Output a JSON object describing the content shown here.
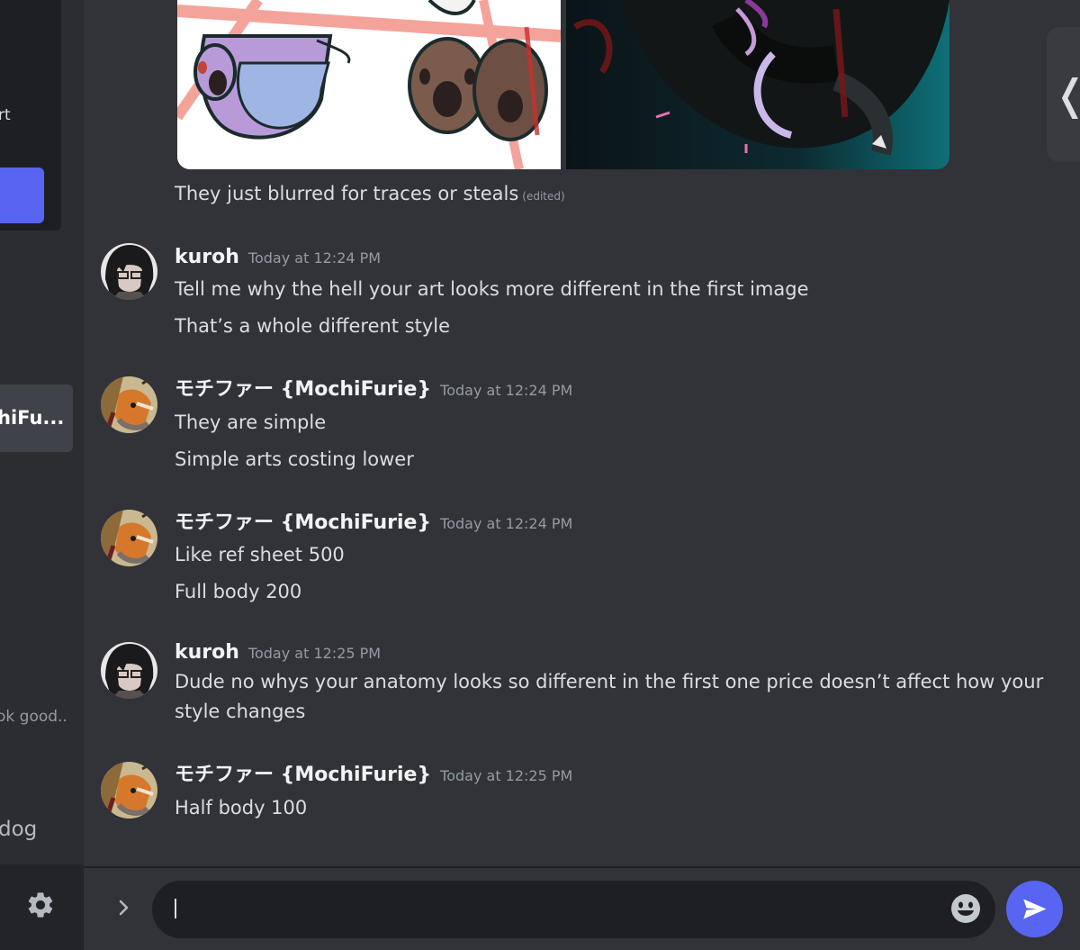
{
  "colors": {
    "background": "#313338",
    "sidebar": "#2b2d31",
    "blurple": "#5865f2",
    "text": "#dbdee1",
    "muted": "#949ba4",
    "input": "#1e1f22"
  },
  "sidebar": {
    "top_text": "rt",
    "selected_dm_label": "hiFu...",
    "preview_text": "ok good..",
    "channel_label": "dog",
    "settings_icon": "gear-icon"
  },
  "attachments": {
    "caption": "They just blurred for traces or steals",
    "edited_label": "(edited)",
    "expand_icon": "chevron-left-icon"
  },
  "messages": [
    {
      "author": "kuroh",
      "timestamp": "Today at 12:24 PM",
      "avatar": "kuroh-avatar",
      "lines": [
        "Tell me why the hell your art looks more different in the first image",
        "That’s a whole different style"
      ]
    },
    {
      "author": "モチファー {MochiFurie}",
      "timestamp": "Today at 12:24 PM",
      "avatar": "mochifurie-avatar",
      "lines": [
        "They are simple",
        "Simple arts costing lower"
      ]
    },
    {
      "author": "モチファー {MochiFurie}",
      "timestamp": "Today at 12:24 PM",
      "avatar": "mochifurie-avatar",
      "lines": [
        "Like ref sheet 500",
        "Full body 200"
      ]
    },
    {
      "author": "kuroh",
      "timestamp": "Today at 12:25 PM",
      "avatar": "kuroh-avatar",
      "lines": [
        "Dude no whys your anatomy looks so different in the first one price doesn’t affect how your style changes"
      ]
    },
    {
      "author": "モチファー {MochiFurie}",
      "timestamp": "Today at 12:25 PM",
      "avatar": "mochifurie-avatar",
      "lines": [
        "Half body 100"
      ]
    }
  ],
  "composer": {
    "value": "",
    "expand_icon": "chevron-right-icon",
    "emoji_icon": "smiley-icon",
    "send_icon": "send-icon"
  }
}
